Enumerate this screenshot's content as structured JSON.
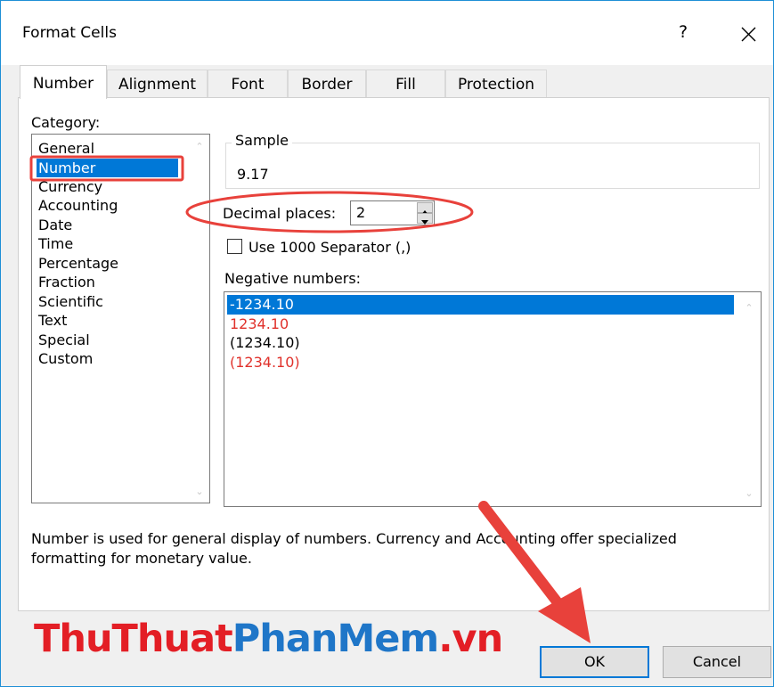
{
  "window": {
    "title": "Format Cells",
    "help_label": "?"
  },
  "tabs": [
    {
      "label": "Number",
      "active": true
    },
    {
      "label": "Alignment"
    },
    {
      "label": "Font"
    },
    {
      "label": "Border"
    },
    {
      "label": "Fill"
    },
    {
      "label": "Protection"
    }
  ],
  "category": {
    "label": "Category:",
    "items": [
      "General",
      "Number",
      "Currency",
      "Accounting",
      "Date",
      "Time",
      "Percentage",
      "Fraction",
      "Scientific",
      "Text",
      "Special",
      "Custom"
    ],
    "selected": "Number"
  },
  "sample": {
    "legend": "Sample",
    "value": "9.17"
  },
  "decimal_places": {
    "label": "Decimal places:",
    "value": "2"
  },
  "separator": {
    "label": "Use 1000 Separator (,)",
    "checked": false
  },
  "negative_numbers": {
    "label": "Negative numbers:",
    "items": [
      {
        "text": "-1234.10",
        "selected": true,
        "color": "#000000"
      },
      {
        "text": "1234.10",
        "color": "#e0312b"
      },
      {
        "text": "(1234.10)",
        "color": "#000000"
      },
      {
        "text": "(1234.10)",
        "color": "#e0312b"
      }
    ]
  },
  "description": {
    "line1": "Number is used for general display of numbers.  Currency and Accounting offer specialized",
    "line2": "formatting for monetary value."
  },
  "buttons": {
    "ok": "OK",
    "cancel": "Cancel"
  },
  "watermark": {
    "part1": "ThuThuat",
    "part2": "PhanMem",
    "part3": ".vn"
  },
  "colors": {
    "selection": "#0078d7",
    "annotation_red": "#e8413b",
    "negative_red": "#e0312b",
    "watermark_red": "#e31e25",
    "watermark_blue": "#1f76c8"
  }
}
